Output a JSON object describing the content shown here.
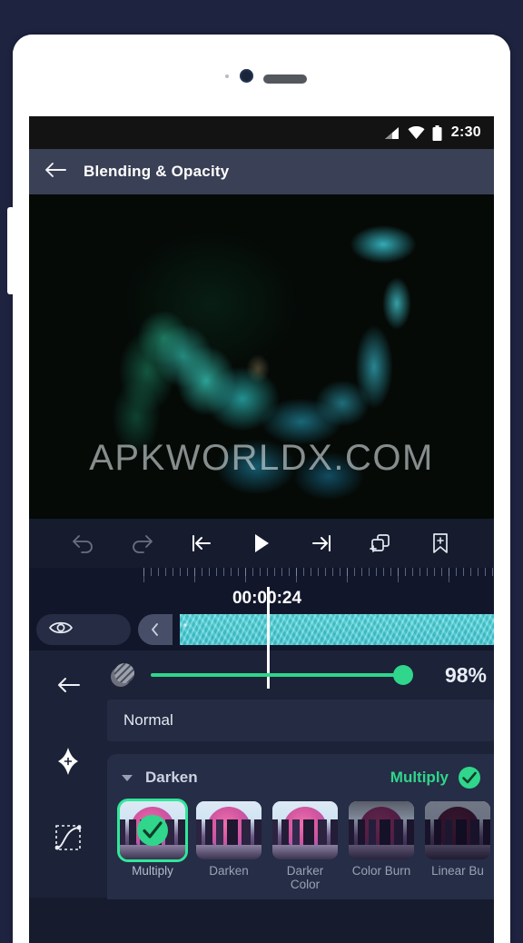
{
  "status_bar": {
    "time": "2:30",
    "icons": [
      "signal-icon",
      "wifi-icon",
      "battery-icon"
    ]
  },
  "app_bar": {
    "back_icon": "back-arrow-icon",
    "title": "Blending & Opacity"
  },
  "preview": {
    "watermark": "APKWORLDX.COM"
  },
  "transport": {
    "buttons": [
      {
        "name": "undo-button",
        "icon": "undo-icon",
        "enabled": false
      },
      {
        "name": "redo-button",
        "icon": "redo-icon",
        "enabled": false
      },
      {
        "name": "skip-to-start-button",
        "icon": "skip-previous-icon",
        "enabled": true
      },
      {
        "name": "play-button",
        "icon": "play-icon",
        "enabled": true
      },
      {
        "name": "skip-to-end-button",
        "icon": "skip-next-icon",
        "enabled": true
      },
      {
        "name": "add-layer-button",
        "icon": "add-layer-icon",
        "enabled": true
      },
      {
        "name": "add-bookmark-button",
        "icon": "add-bookmark-icon",
        "enabled": true
      }
    ]
  },
  "timeline": {
    "timecode": "00:00:24",
    "visibility_icon": "eye-icon",
    "clip_handle_icon": "chevron-left-icon"
  },
  "side_rail": {
    "items": [
      {
        "name": "panel-back-button",
        "icon": "back-arrow-icon"
      },
      {
        "name": "keyframe-button",
        "icon": "keyframe-diamond-icon"
      },
      {
        "name": "easing-curve-button",
        "icon": "easing-curve-icon"
      }
    ]
  },
  "opacity": {
    "icon": "opacity-icon",
    "value_label": "98%",
    "value": 98,
    "track_color": "#2fd68b"
  },
  "blend_mode": {
    "current_label": "Normal",
    "category": "Darken",
    "caret_icon": "caret-down-icon",
    "selected_label": "Multiply",
    "check_icon": "check-circle-icon",
    "accent_color": "#2fd68b",
    "modes": [
      {
        "label": "Multiply",
        "selected": true
      },
      {
        "label": "Darken",
        "selected": false
      },
      {
        "label": "Darker Color",
        "selected": false
      },
      {
        "label": "Color Burn",
        "selected": false
      },
      {
        "label": "Linear Bu",
        "selected": false
      }
    ]
  }
}
